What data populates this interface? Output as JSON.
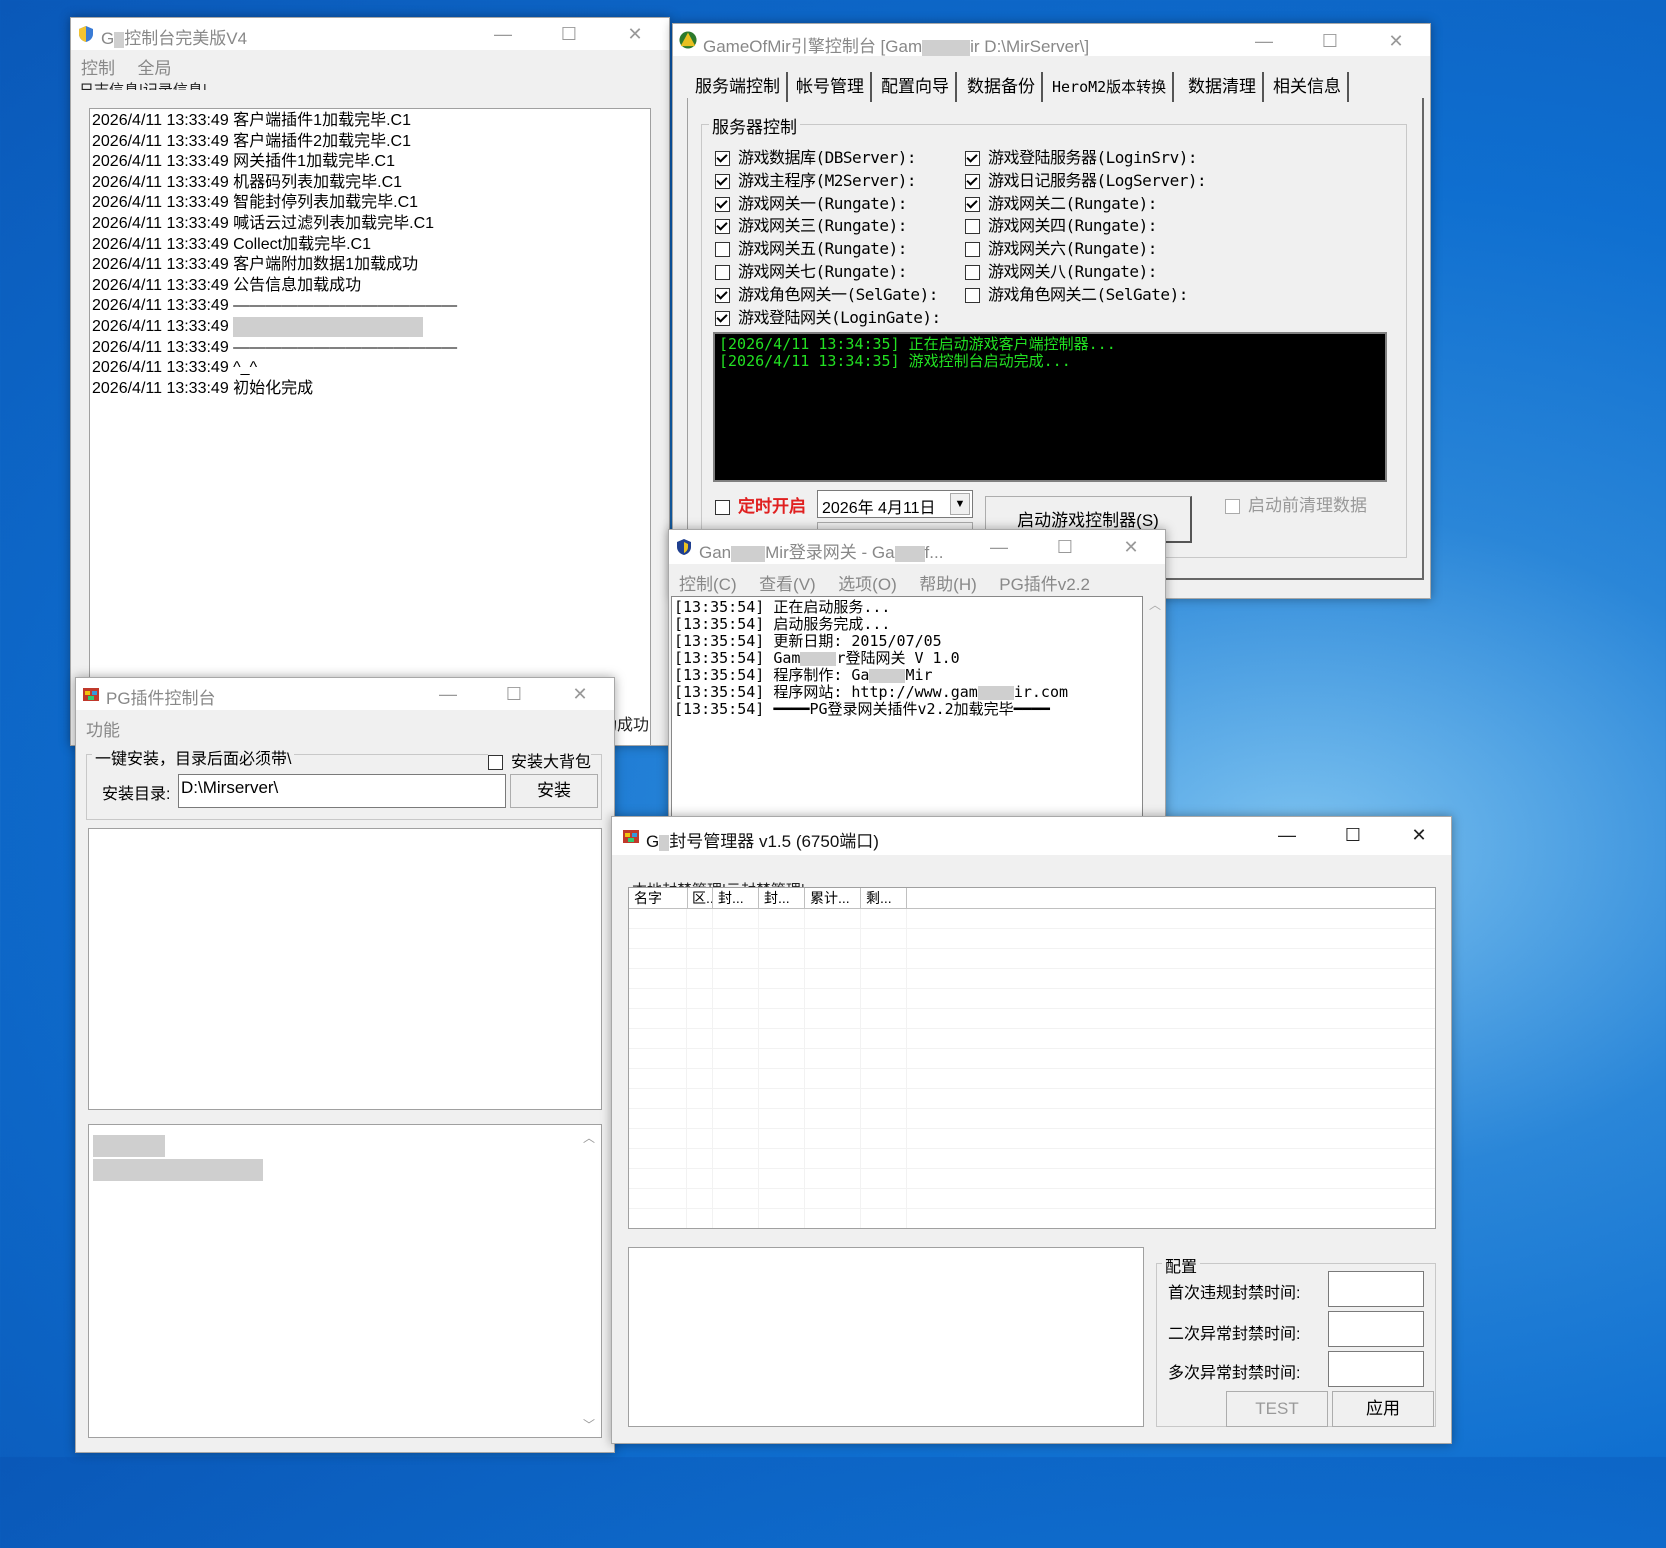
{
  "win1": {
    "title_prefix": "G",
    "title_suffix": "控制台完美版V4",
    "menu": [
      "控制",
      "全局"
    ],
    "tabs_cut": "日志信息|记录信息|",
    "log": [
      {
        "ts": "2026/4/11 13:33:49",
        "msg": "客户端插件1加载完毕.C1"
      },
      {
        "ts": "2026/4/11 13:33:49",
        "msg": "客户端插件2加载完毕.C1"
      },
      {
        "ts": "2026/4/11 13:33:49",
        "msg": "网关插件1加载完毕.C1"
      },
      {
        "ts": "2026/4/11 13:33:49",
        "msg": "机器码列表加载完毕.C1"
      },
      {
        "ts": "2026/4/11 13:33:49",
        "msg": "智能封停列表加载完毕.C1"
      },
      {
        "ts": "2026/4/11 13:33:49",
        "msg": "喊话云过滤列表加载完毕.C1"
      },
      {
        "ts": "2026/4/11 13:33:49",
        "msg": "Collect加载完毕.C1"
      },
      {
        "ts": "2026/4/11 13:33:49",
        "msg": "客户端附加数据1加载成功"
      },
      {
        "ts": "2026/4/11 13:33:49",
        "msg": "公告信息加载成功"
      },
      {
        "ts": "2026/4/11 13:33:49",
        "msg": "——————————————"
      },
      {
        "ts": "2026/4/11 13:33:49",
        "msg": ""
      },
      {
        "ts": "2026/4/11 13:33:49",
        "msg": "——————————————"
      },
      {
        "ts": "2026/4/11 13:33:49",
        "msg": "^_^"
      },
      {
        "ts": "2026/4/11 13:33:49",
        "msg": "初始化完成"
      }
    ],
    "peek_text": "功成功"
  },
  "win2": {
    "title_prefix": "GameOfMir引擎控制台 [Gam",
    "title_suffix": "ir D:\\MirServer\\]",
    "tabs": [
      "服务端控制",
      "帐号管理",
      "配置向导",
      "数据备份",
      "HeroM2版本转换",
      "数据清理",
      "相关信息"
    ],
    "group_label": "服务器控制",
    "left_checks": [
      {
        "label": "游戏数据库(DBServer):",
        "checked": true
      },
      {
        "label": "游戏主程序(M2Server):",
        "checked": true
      },
      {
        "label": "游戏网关一(Rungate):",
        "checked": true
      },
      {
        "label": "游戏网关三(Rungate):",
        "checked": true
      },
      {
        "label": "游戏网关五(Rungate):",
        "checked": false
      },
      {
        "label": "游戏网关七(Rungate):",
        "checked": false
      },
      {
        "label": "游戏角色网关一(SelGate):",
        "checked": true
      },
      {
        "label": "游戏登陆网关(LoginGate):",
        "checked": true
      }
    ],
    "right_checks": [
      {
        "label": "游戏登陆服务器(LoginSrv):",
        "checked": true
      },
      {
        "label": "游戏日记服务器(LogServer):",
        "checked": true
      },
      {
        "label": "游戏网关二(Rungate):",
        "checked": true
      },
      {
        "label": "游戏网关四(Rungate):",
        "checked": false
      },
      {
        "label": "游戏网关六(Rungate):",
        "checked": false
      },
      {
        "label": "游戏网关八(Rungate):",
        "checked": false
      },
      {
        "label": "游戏角色网关二(SelGate):",
        "checked": false
      }
    ],
    "console": [
      "[2026/4/11 13:34:35] 正在启动游戏客户端控制器...",
      "[2026/4/11 13:34:35] 游戏控制台启动完成..."
    ],
    "timer_label": "定时开启",
    "date_value": "2026年 4月11日",
    "start_button": "启动游戏控制器(S)",
    "clean_label": "启动前清理数据",
    "accent_red": "#e02020",
    "console_green": "#22e022"
  },
  "win3": {
    "title_a": "Gan",
    "title_b": "Mir登录网关 - Ga",
    "title_c": "f...",
    "menu": [
      "控制(C)",
      "查看(V)",
      "选项(O)",
      "帮助(H)",
      "PG插件v2.2"
    ],
    "log": [
      {
        "ts": "[13:35:54]",
        "a": "正在启动服务...",
        "b": ""
      },
      {
        "ts": "[13:35:54]",
        "a": "启动服务完成...",
        "b": ""
      },
      {
        "ts": "[13:35:54]",
        "a": "更新日期: 2015/07/05",
        "b": ""
      },
      {
        "ts": "[13:35:54]",
        "a": "Gam",
        "b": "r登陆网关 V 1.0"
      },
      {
        "ts": "[13:35:54]",
        "a": "程序制作: Ga",
        "b": "Mir"
      },
      {
        "ts": "[13:35:54]",
        "a": "程序网站: http://www.gam",
        "b": "ir.com"
      },
      {
        "ts": "[13:35:54]",
        "a": "━━━━PG登录网关插件v2.2加载完毕━━━━",
        "b": ""
      }
    ]
  },
  "win4": {
    "title": "PG插件控制台",
    "menu": [
      "功能"
    ],
    "group_label": "一键安装，目录后面必须带\\",
    "bigpack_label": "安装大背包",
    "dir_label": "安装目录:",
    "dir_value": "D:\\Mirserver\\",
    "install_button": "安装"
  },
  "win5": {
    "title_prefix": "G",
    "title_suffix": "封号管理器 v1.5 (6750端口)",
    "tabs_cut": "本地封禁管理|云封禁管理|",
    "columns": [
      "名字",
      "区...",
      "封...",
      "封...",
      "累计...",
      "剩..."
    ],
    "config_label": "配置",
    "fields": [
      {
        "label": "首次违规封禁时间:",
        "value": ""
      },
      {
        "label": "二次异常封禁时间:",
        "value": ""
      },
      {
        "label": "多次异常封禁时间:",
        "value": ""
      }
    ],
    "test_button": "TEST",
    "apply_button": "应用"
  }
}
